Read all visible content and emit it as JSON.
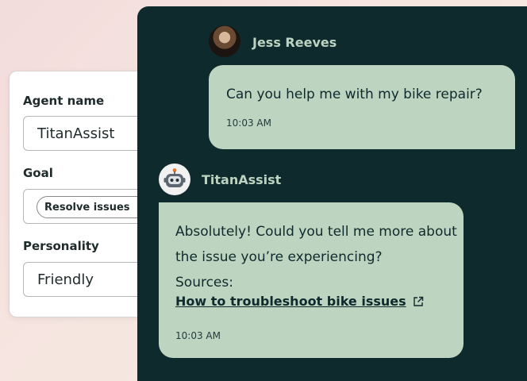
{
  "config": {
    "agent_name_label": "Agent name",
    "agent_name_value": "TitanAssist",
    "goal_label": "Goal",
    "goal_chip": "Resolve issues",
    "goal_chip_close": "×",
    "personality_label": "Personality",
    "personality_value": "Friendly"
  },
  "chat": {
    "user": {
      "name": "Jess Reeves",
      "message": "Can you help me with my bike repair?",
      "time": "10:03 AM"
    },
    "bot": {
      "name": "TitanAssist",
      "message_line1": "Absolutely! Could you tell me more about",
      "message_line2": "the issue you’re experiencing?",
      "sources_label": "Sources:",
      "source_link": "How to troubleshoot bike issues",
      "time": "10:03 AM"
    }
  },
  "colors": {
    "panel_bg": "#0e2a2d",
    "bubble_bg": "#bdd4c1",
    "name_text": "#bcd3c1"
  },
  "icons": {
    "bot_avatar": "robot-icon",
    "external_link": "external-link-icon"
  }
}
